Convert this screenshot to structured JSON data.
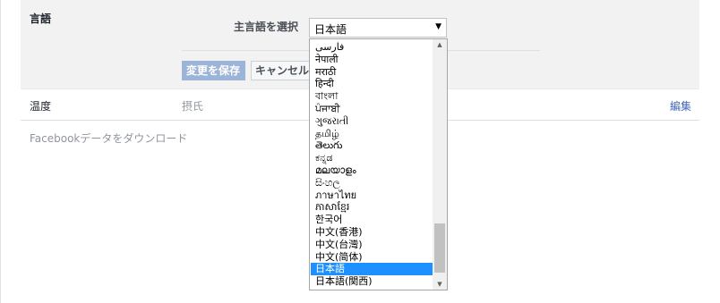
{
  "language_section": {
    "heading": "言語",
    "select_label": "主言語を選択",
    "selected_value": "日本語",
    "save_label": "変更を保存",
    "cancel_label": "キャンセル"
  },
  "temperature_row": {
    "label": "温度",
    "value": "摂氏",
    "edit_label": "編集"
  },
  "download_link": "Facebookデータをダウンロード",
  "dropdown": {
    "options": [
      {
        "label": "فارسی",
        "selected": false
      },
      {
        "label": "नेपाली",
        "selected": false
      },
      {
        "label": "मराठी",
        "selected": false
      },
      {
        "label": "हिन्दी",
        "selected": false
      },
      {
        "label": "বাংলা",
        "selected": false
      },
      {
        "label": "ਪੰਜਾਬੀ",
        "selected": false
      },
      {
        "label": "ગુજરાતી",
        "selected": false
      },
      {
        "label": "தமிழ்",
        "selected": false
      },
      {
        "label": "తెలుగు",
        "selected": false
      },
      {
        "label": "ಕನ್ನಡ",
        "selected": false
      },
      {
        "label": "മലയാളം",
        "selected": false
      },
      {
        "label": "සිංහල",
        "selected": false
      },
      {
        "label": "ภาษาไทย",
        "selected": false
      },
      {
        "label": "ភាសាខ្មែរ",
        "selected": false
      },
      {
        "label": "한국어",
        "selected": false
      },
      {
        "label": "中文(香港)",
        "selected": false
      },
      {
        "label": "中文(台灣)",
        "selected": false
      },
      {
        "label": "中文(简体)",
        "selected": false
      },
      {
        "label": "日本語",
        "selected": true
      },
      {
        "label": "日本語(関西)",
        "selected": false
      }
    ],
    "scroll_position": 0.82
  },
  "colors": {
    "selection_highlight": "#1e90ff",
    "link": "#4267b2",
    "save_button": "#9cb4d8"
  }
}
